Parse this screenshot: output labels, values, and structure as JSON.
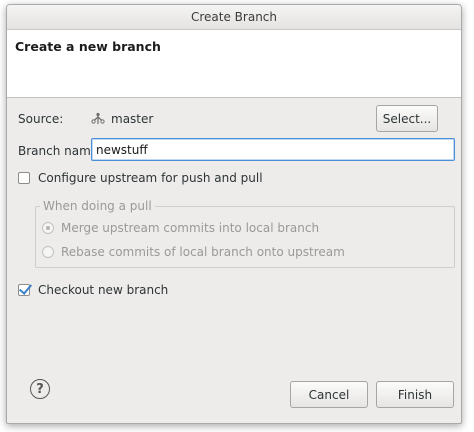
{
  "window": {
    "title": "Create Branch"
  },
  "banner": {
    "title": "Create a new branch"
  },
  "source": {
    "label": "Source:",
    "value": "master",
    "icon": "branch-icon",
    "select_button": "Select..."
  },
  "branch_name": {
    "label": "Branch name:",
    "value": "newstuff",
    "placeholder": ""
  },
  "configure_upstream": {
    "label": "Configure upstream for push and pull",
    "checked": false
  },
  "pull_group": {
    "legend": "When doing a pull",
    "options": [
      {
        "label": "Merge upstream commits into local branch",
        "selected": true
      },
      {
        "label": "Rebase commits of local branch onto upstream",
        "selected": false
      }
    ]
  },
  "checkout": {
    "label": "Checkout new branch",
    "checked": true
  },
  "footer": {
    "help_icon": "?",
    "cancel_button": "Cancel",
    "finish_button": "Finish"
  },
  "colors": {
    "dialog_bg": "#edeceb",
    "focus_border": "#4a90d9",
    "check_accent": "#3c7fc9"
  }
}
